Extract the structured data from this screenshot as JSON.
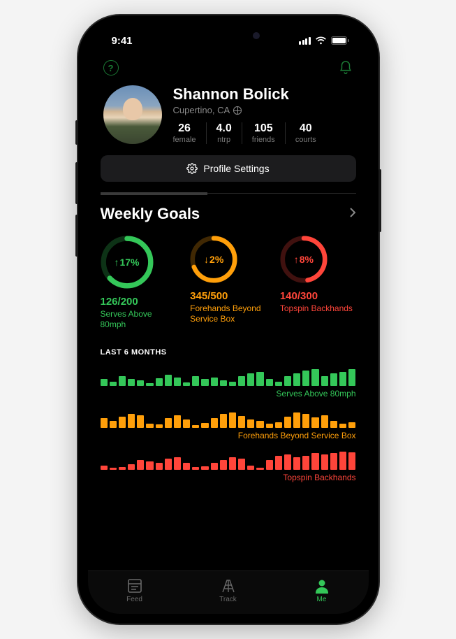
{
  "status": {
    "time": "9:41"
  },
  "profile": {
    "name": "Shannon Bolick",
    "location": "Cupertino, CA",
    "stats": [
      {
        "value": "26",
        "label": "female"
      },
      {
        "value": "4.0",
        "label": "ntrp"
      },
      {
        "value": "105",
        "label": "friends"
      },
      {
        "value": "40",
        "label": "courts"
      }
    ],
    "settings_label": "Profile Settings"
  },
  "weekly_goals": {
    "title": "Weekly Goals",
    "items": [
      {
        "pct": "17%",
        "dir": "up",
        "count": "126/200",
        "name": "Serves Above 80mph",
        "color": "green",
        "fill": 0.63
      },
      {
        "pct": "2%",
        "dir": "down",
        "count": "345/500",
        "name": "Forehands Beyond Service Box",
        "color": "orange",
        "fill": 0.69
      },
      {
        "pct": "8%",
        "dir": "up",
        "count": "140/300",
        "name": "Topspin Backhands",
        "color": "red",
        "fill": 0.47
      }
    ]
  },
  "history": {
    "title": "LAST 6 MONTHS",
    "rows": [
      {
        "label": "Serves Above 80mph",
        "color": "green",
        "bars": [
          10,
          6,
          14,
          10,
          8,
          4,
          11,
          16,
          12,
          5,
          14,
          10,
          12,
          8,
          6,
          14,
          18,
          20,
          10,
          6,
          14,
          18,
          22,
          24,
          14,
          18,
          20,
          24
        ]
      },
      {
        "label": "Forehands Beyond Service Box",
        "color": "orange",
        "bars": [
          14,
          10,
          16,
          20,
          18,
          6,
          5,
          14,
          18,
          12,
          4,
          7,
          14,
          20,
          22,
          17,
          12,
          10,
          6,
          8,
          16,
          22,
          20,
          15,
          18,
          10,
          6,
          8
        ]
      },
      {
        "label": "Topspin Backhands",
        "color": "red",
        "bars": [
          6,
          3,
          4,
          8,
          14,
          12,
          10,
          16,
          18,
          10,
          4,
          5,
          10,
          14,
          18,
          16,
          6,
          3,
          14,
          20,
          22,
          18,
          20,
          24,
          22,
          24,
          26,
          25
        ]
      }
    ]
  },
  "tabs": [
    {
      "label": "Feed",
      "active": false
    },
    {
      "label": "Track",
      "active": false
    },
    {
      "label": "Me",
      "active": true
    }
  ],
  "colors": {
    "green": "#34c759",
    "orange": "#ff9f0a",
    "red": "#ff453a"
  }
}
